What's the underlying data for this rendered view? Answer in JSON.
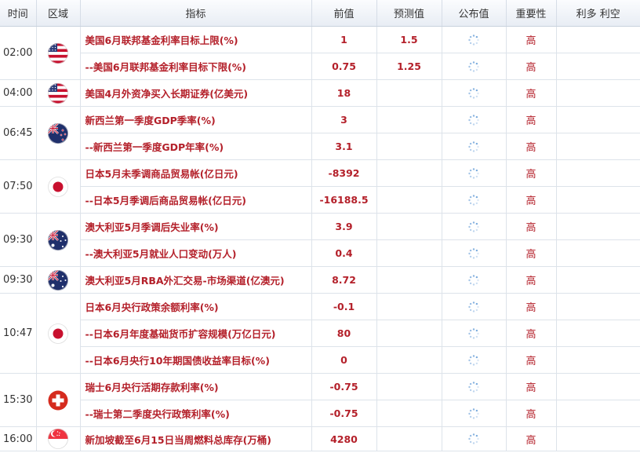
{
  "columns": {
    "time": "时间",
    "region": "区域",
    "indicator": "指标",
    "previous": "前值",
    "forecast": "预测值",
    "published": "公布值",
    "importance": "重要性",
    "effect": "利多 利空"
  },
  "groups": [
    {
      "time": "02:00",
      "flag": "us-flag-icon",
      "rows": [
        {
          "indicator": "美国6月联邦基金利率目标上限(%)",
          "previous": "1",
          "forecast": "1.5",
          "importance": "高"
        },
        {
          "indicator": "--美国6月联邦基金利率目标下限(%)",
          "previous": "0.75",
          "forecast": "1.25",
          "importance": "高"
        }
      ]
    },
    {
      "time": "04:00",
      "flag": "us-flag-icon",
      "rows": [
        {
          "indicator": "美国4月外资净买入长期证券(亿美元)",
          "previous": "18",
          "forecast": "",
          "importance": "高"
        }
      ]
    },
    {
      "time": "06:45",
      "flag": "nz-flag-icon",
      "rows": [
        {
          "indicator": "新西兰第一季度GDP季率(%)",
          "previous": "3",
          "forecast": "",
          "importance": "高"
        },
        {
          "indicator": "--新西兰第一季度GDP年率(%)",
          "previous": "3.1",
          "forecast": "",
          "importance": "高"
        }
      ]
    },
    {
      "time": "07:50",
      "flag": "jp-flag-icon",
      "rows": [
        {
          "indicator": "日本5月未季调商品贸易帐(亿日元)",
          "previous": "-8392",
          "forecast": "",
          "importance": "高"
        },
        {
          "indicator": "--日本5月季调后商品贸易帐(亿日元)",
          "previous": "-16188.5",
          "forecast": "",
          "importance": "高"
        }
      ]
    },
    {
      "time": "09:30",
      "flag": "au-flag-icon",
      "rows": [
        {
          "indicator": "澳大利亚5月季调后失业率(%)",
          "previous": "3.9",
          "forecast": "",
          "importance": "高"
        },
        {
          "indicator": "--澳大利亚5月就业人口变动(万人)",
          "previous": "0.4",
          "forecast": "",
          "importance": "高"
        }
      ]
    },
    {
      "time": "09:30",
      "flag": "au-flag-icon",
      "rows": [
        {
          "indicator": "澳大利亚5月RBA外汇交易-市场渠道(亿澳元)",
          "previous": "8.72",
          "forecast": "",
          "importance": "高"
        }
      ]
    },
    {
      "time": "10:47",
      "flag": "jp-flag-icon",
      "rows": [
        {
          "indicator": "日本6月央行政策余额利率(%)",
          "previous": "-0.1",
          "forecast": "",
          "importance": "高"
        },
        {
          "indicator": "--日本6月年度基础货币扩容规模(万亿日元)",
          "previous": "80",
          "forecast": "",
          "importance": "高"
        },
        {
          "indicator": "--日本6月央行10年期国债收益率目标(%)",
          "previous": "0",
          "forecast": "",
          "importance": "高"
        }
      ]
    },
    {
      "time": "15:30",
      "flag": "ch-flag-icon",
      "rows": [
        {
          "indicator": "瑞士6月央行活期存款利率(%)",
          "previous": "-0.75",
          "forecast": "",
          "importance": "高"
        },
        {
          "indicator": "--瑞士第二季度央行政策利率(%)",
          "previous": "-0.75",
          "forecast": "",
          "importance": "高"
        }
      ]
    },
    {
      "time": "16:00",
      "flag": "sg-flag-icon",
      "rows": [
        {
          "indicator": "新加坡截至6月15日当周燃料总库存(万桶)",
          "previous": "4280",
          "forecast": "",
          "importance": "高"
        }
      ]
    }
  ],
  "colors": {
    "accent": "#b4202a",
    "header_bg": "#e8edf4",
    "border": "#dde3ea"
  }
}
